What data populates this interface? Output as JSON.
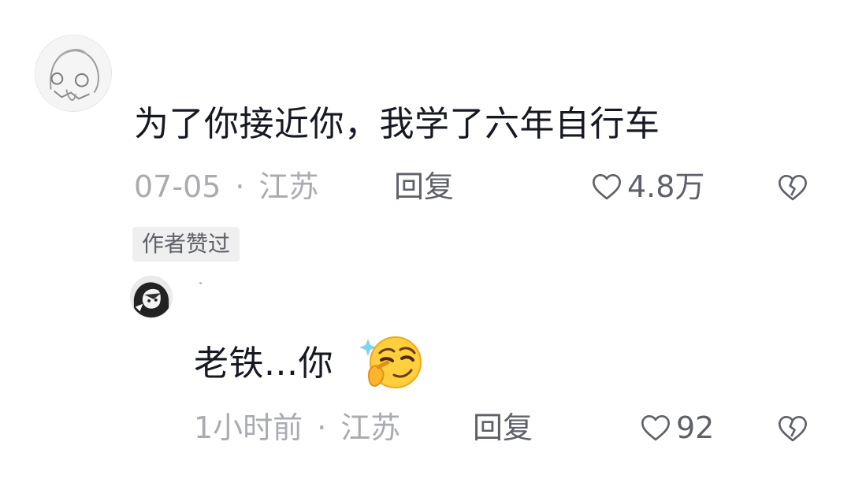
{
  "comments": [
    {
      "avatar_icon": "sketch-avatar-icon",
      "text": "为了你接近你，我学了六年自行车",
      "date": "07-05",
      "separator": "·",
      "location": "江苏",
      "reply_label": "回复",
      "like_count": "4.8万",
      "badge": "作者赞过"
    },
    {
      "avatar_icon": "anime-avatar-icon",
      "text": "老铁...你",
      "emoji_icon": "thinking-smirk-emoji-icon",
      "date": "1小时前",
      "separator": "·",
      "location": "江苏",
      "reply_label": "回复",
      "like_count": "92"
    }
  ],
  "colors": {
    "text": "#161823",
    "meta": "#a9abb1",
    "action": "#5f6169",
    "badge_bg": "#efefef"
  }
}
